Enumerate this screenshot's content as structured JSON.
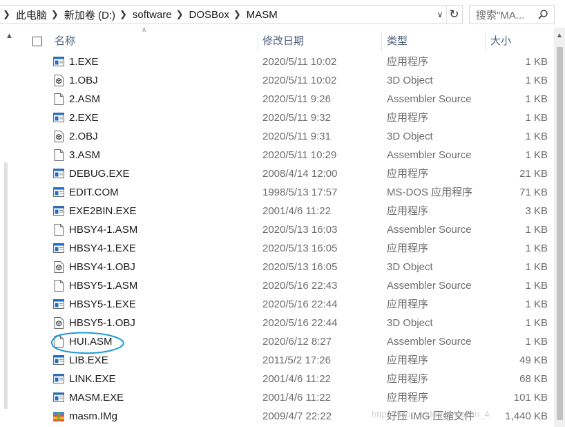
{
  "address": {
    "crumbs": [
      "此电脑",
      "新加卷 (D:)",
      "software",
      "DOSBox",
      "MASM"
    ],
    "search_placeholder": "搜索\"MA..."
  },
  "columns": {
    "name": "名称",
    "date": "修改日期",
    "type": "类型",
    "size": "大小"
  },
  "files": [
    {
      "name": "1.EXE",
      "date": "2020/5/11 10:02",
      "type": "应用程序",
      "size": "1 KB",
      "icon": "exe-icon"
    },
    {
      "name": "1.OBJ",
      "date": "2020/5/11 10:02",
      "type": "3D Object",
      "size": "1 KB",
      "icon": "obj-icon"
    },
    {
      "name": "2.ASM",
      "date": "2020/5/11 9:26",
      "type": "Assembler Source",
      "size": "1 KB",
      "icon": "asm-icon"
    },
    {
      "name": "2.EXE",
      "date": "2020/5/11 9:32",
      "type": "应用程序",
      "size": "1 KB",
      "icon": "exe-icon"
    },
    {
      "name": "2.OBJ",
      "date": "2020/5/11 9:31",
      "type": "3D Object",
      "size": "1 KB",
      "icon": "obj-icon"
    },
    {
      "name": "3.ASM",
      "date": "2020/5/11 10:29",
      "type": "Assembler Source",
      "size": "1 KB",
      "icon": "asm-icon"
    },
    {
      "name": "DEBUG.EXE",
      "date": "2008/4/14 12:00",
      "type": "应用程序",
      "size": "21 KB",
      "icon": "exe-icon"
    },
    {
      "name": "EDIT.COM",
      "date": "1998/5/13 17:57",
      "type": "MS-DOS 应用程序",
      "size": "71 KB",
      "icon": "exe-icon"
    },
    {
      "name": "EXE2BIN.EXE",
      "date": "2001/4/6 11:22",
      "type": "应用程序",
      "size": "3 KB",
      "icon": "exe-icon"
    },
    {
      "name": "HBSY4-1.ASM",
      "date": "2020/5/13 16:03",
      "type": "Assembler Source",
      "size": "1 KB",
      "icon": "asm-icon"
    },
    {
      "name": "HBSY4-1.EXE",
      "date": "2020/5/13 16:05",
      "type": "应用程序",
      "size": "1 KB",
      "icon": "exe-icon"
    },
    {
      "name": "HBSY4-1.OBJ",
      "date": "2020/5/13 16:05",
      "type": "3D Object",
      "size": "1 KB",
      "icon": "obj-icon"
    },
    {
      "name": "HBSY5-1.ASM",
      "date": "2020/5/16 22:43",
      "type": "Assembler Source",
      "size": "1 KB",
      "icon": "asm-icon"
    },
    {
      "name": "HBSY5-1.EXE",
      "date": "2020/5/16 22:44",
      "type": "应用程序",
      "size": "1 KB",
      "icon": "exe-icon"
    },
    {
      "name": "HBSY5-1.OBJ",
      "date": "2020/5/16 22:44",
      "type": "3D Object",
      "size": "1 KB",
      "icon": "obj-icon"
    },
    {
      "name": "HUI.ASM",
      "date": "2020/6/12 8:27",
      "type": "Assembler Source",
      "size": "1 KB",
      "icon": "asm-icon"
    },
    {
      "name": "LIB.EXE",
      "date": "2011/5/2 17:26",
      "type": "应用程序",
      "size": "49 KB",
      "icon": "exe-icon"
    },
    {
      "name": "LINK.EXE",
      "date": "2001/4/6 11:22",
      "type": "应用程序",
      "size": "68 KB",
      "icon": "exe-icon"
    },
    {
      "name": "MASM.EXE",
      "date": "2001/4/6 11:22",
      "type": "应用程序",
      "size": "101 KB",
      "icon": "exe-icon"
    },
    {
      "name": "masm.IMg",
      "date": "2009/4/7 22:22",
      "type": "好压 IMG 压缩文件",
      "size": "1,440 KB",
      "icon": "archive-icon"
    }
  ],
  "colors": {
    "header_text": "#4c607a",
    "annotation": "#1e9ad6",
    "exe_blue": "#1f6fc5"
  }
}
